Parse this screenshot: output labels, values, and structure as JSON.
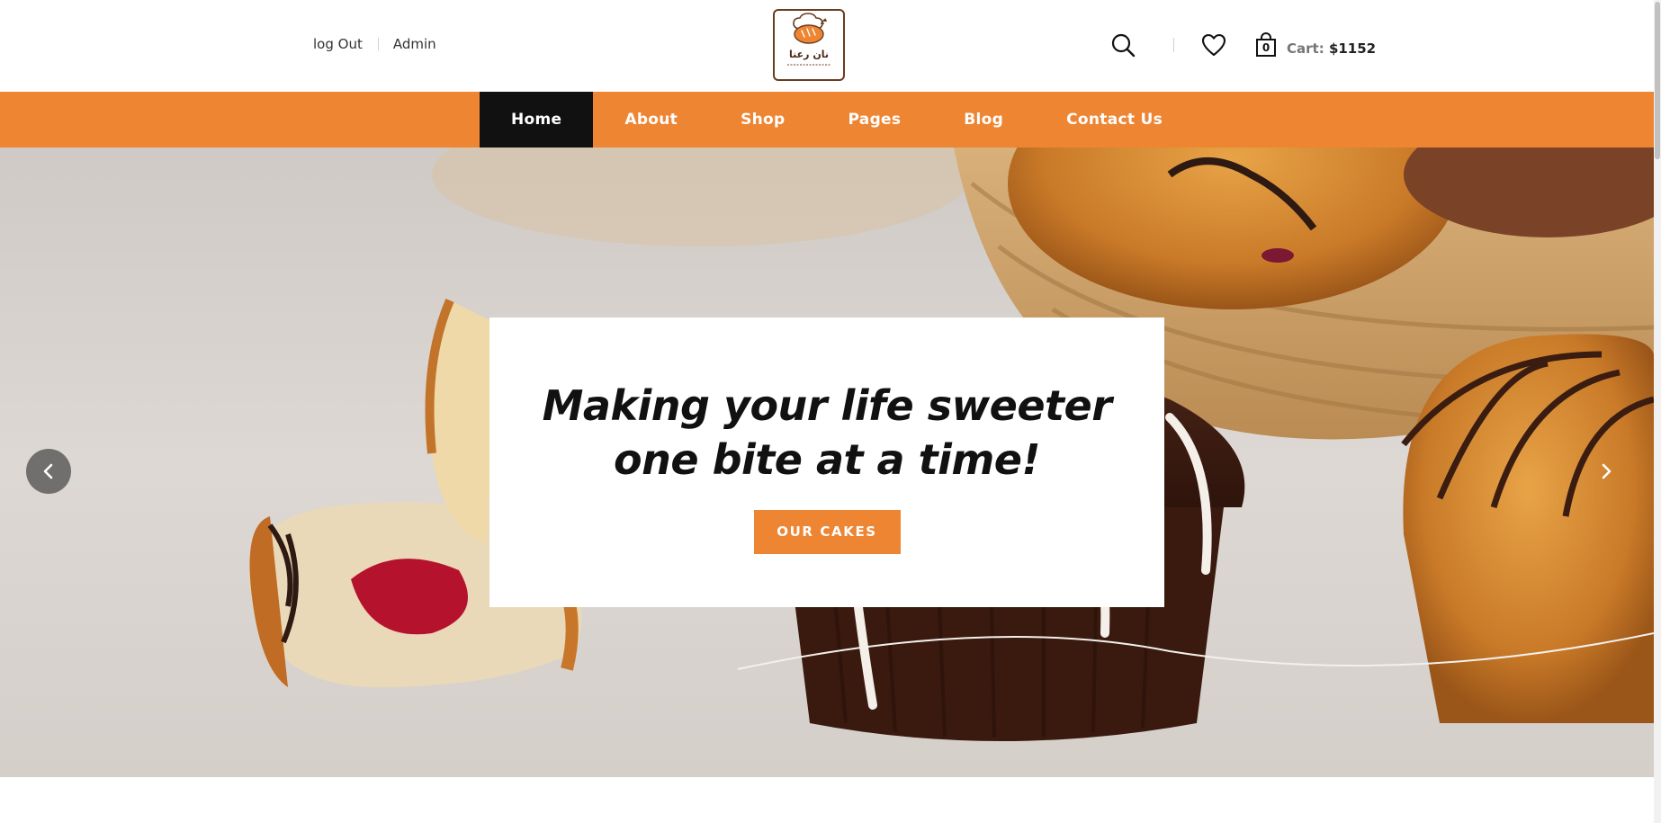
{
  "header": {
    "account_links": [
      "log Out",
      "Admin"
    ],
    "logo_text": "نان رعنا",
    "cart_count": "0",
    "cart_label": "Cart:",
    "cart_total": "$1152"
  },
  "nav": {
    "items": [
      "Home",
      "About",
      "Shop",
      "Pages",
      "Blog",
      "Contact Us"
    ],
    "active": "Home"
  },
  "hero": {
    "title_line1": "Making your life sweeter",
    "title_line2": "one bite at a time!",
    "cta_label": "OUR CAKES"
  },
  "icons": {
    "search": "search-icon",
    "wishlist": "heart-icon",
    "cart": "shopping-bag-icon",
    "prev": "chevron-left-icon",
    "next": "chevron-right-icon"
  },
  "colors": {
    "accent": "#ee8533",
    "active_nav": "#111111",
    "logo_border": "#6b3b1f"
  }
}
